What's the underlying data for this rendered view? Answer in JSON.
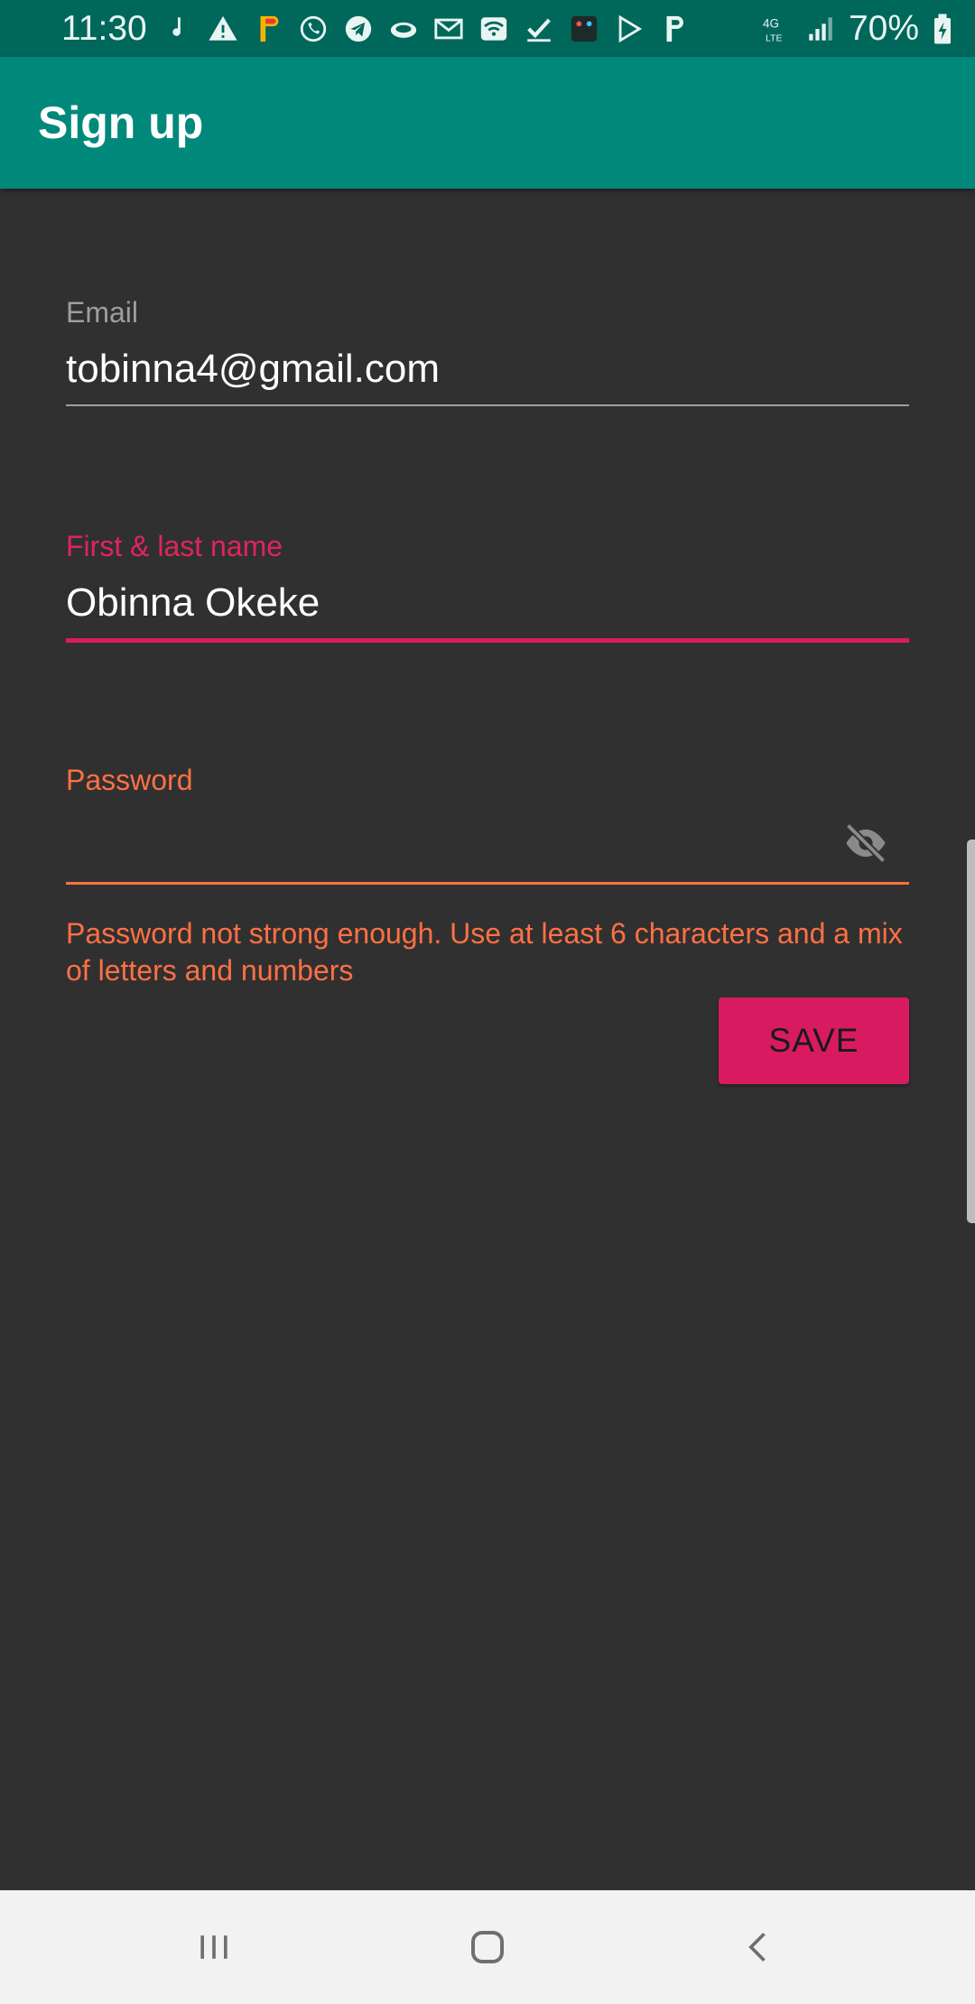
{
  "status_bar": {
    "time": "11:30",
    "battery": "70%",
    "network": "4G LTE",
    "notification_icons": [
      "music-note-icon",
      "warning-icon",
      "play-store-app-icon",
      "whatsapp-icon",
      "telegram-icon",
      "cloud-icon",
      "gmail-icon",
      "wifi-icon",
      "check-icon",
      "app-icon",
      "play-store-icon",
      "pinterest-icon"
    ]
  },
  "app_bar": {
    "title": "Sign up"
  },
  "form": {
    "email": {
      "label": "Email",
      "value": "tobinna4@gmail.com"
    },
    "name": {
      "label": "First & last name",
      "value": "Obinna Okeke"
    },
    "password": {
      "label": "Password",
      "value": "",
      "error": "Password not strong enough. Use at least 6 characters and a mix of letters and numbers",
      "toggle_icon": "visibility-off-icon"
    },
    "save_label": "SAVE"
  },
  "nav_bar": {
    "icons": [
      "recent-apps-icon",
      "home-icon",
      "back-icon"
    ]
  },
  "colors": {
    "primary": "#00897b",
    "primary_dark": "#00675b",
    "accent": "#d81b60",
    "error": "#ff7043",
    "background": "#303030"
  }
}
